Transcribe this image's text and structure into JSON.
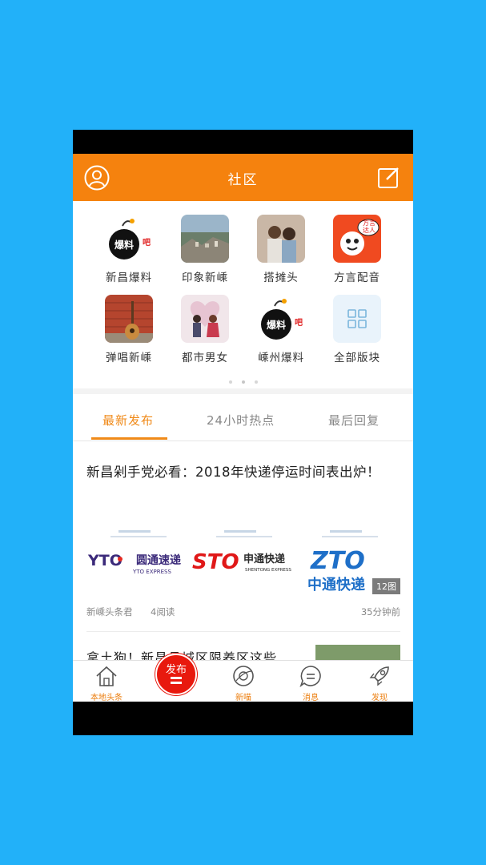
{
  "header": {
    "title": "社区"
  },
  "sections": [
    {
      "label": "新昌爆料"
    },
    {
      "label": "印象新嵊"
    },
    {
      "label": "搭摊头"
    },
    {
      "label": "方言配音",
      "badge": "方言达人"
    },
    {
      "label": "弹唱新嵊"
    },
    {
      "label": "都市男女"
    },
    {
      "label": "嵊州爆料"
    },
    {
      "label": "全部版块"
    }
  ],
  "bomb_text": {
    "main": "爆料",
    "suffix": "吧"
  },
  "tabs": [
    {
      "label": "最新发布"
    },
    {
      "label": "24小时热点"
    },
    {
      "label": "最后回复"
    }
  ],
  "article": {
    "title": "新昌剁手党必看：2018年快递停运时间表出炉！",
    "image_count": "12图",
    "source": "新嵊头条君",
    "reads": "4阅读",
    "time": "35分钟前",
    "logos": [
      {
        "brand": "YTO",
        "name": "圆通速递",
        "sub": "YTO EXPRESS"
      },
      {
        "brand": "STO",
        "name": "申通快递",
        "sub": "SHENTONG EXPRESS"
      },
      {
        "brand": "ZTO",
        "name": "中通快递"
      }
    ]
  },
  "article2": {
    "title": "拿土狗！新昌县城区限养区这些"
  },
  "bottom_nav": [
    {
      "label": "本地头条"
    },
    {
      "label": "发布"
    },
    {
      "label": "新喵"
    },
    {
      "label": "消息"
    },
    {
      "label": "发现"
    }
  ],
  "colors": {
    "accent": "#f5820e",
    "page_bg": "#22b1f9",
    "publish": "#e8190e"
  }
}
